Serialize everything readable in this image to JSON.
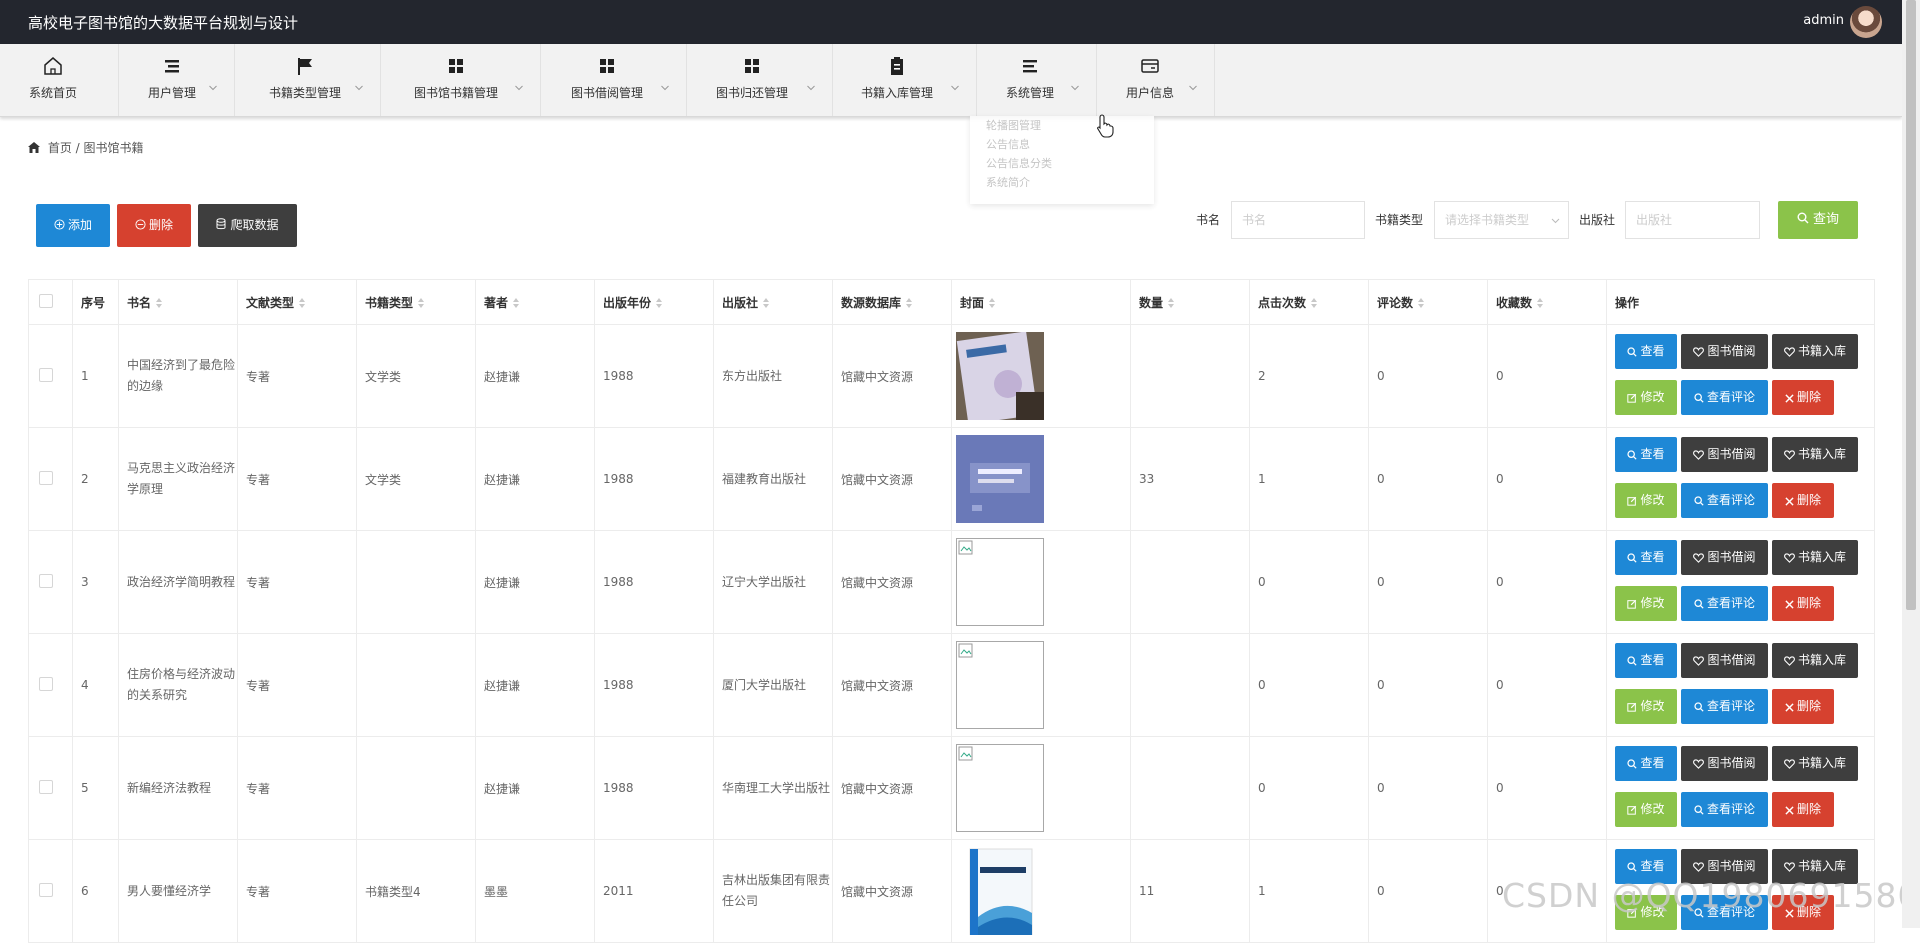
{
  "header": {
    "title": "高校电子图书馆的大数据平台规划与设计",
    "user": "admin"
  },
  "nav": [
    {
      "label": "系统首页",
      "icon": "home-icon"
    },
    {
      "label": "用户管理",
      "icon": "list-icon"
    },
    {
      "label": "书籍类型管理",
      "icon": "flag-icon"
    },
    {
      "label": "图书馆书籍管理",
      "icon": "grid-icon"
    },
    {
      "label": "图书借阅管理",
      "icon": "grid-icon"
    },
    {
      "label": "图书归还管理",
      "icon": "grid-icon"
    },
    {
      "label": "书籍入库管理",
      "icon": "clipboard-icon"
    },
    {
      "label": "系统管理",
      "icon": "menu-icon"
    },
    {
      "label": "用户信息",
      "icon": "card-icon"
    }
  ],
  "dropdown": [
    "轮播图管理",
    "公告信息",
    "公告信息分类",
    "系统简介"
  ],
  "breadcrumb": {
    "home": "首页",
    "sep": "/",
    "current": "图书馆书籍"
  },
  "toolbar": {
    "add": "添加",
    "delete": "删除",
    "crawl": "爬取数据"
  },
  "search": {
    "name_label": "书名",
    "name_placeholder": "书名",
    "type_label": "书籍类型",
    "type_placeholder": "请选择书籍类型",
    "publisher_label": "出版社",
    "publisher_placeholder": "出版社",
    "button": "查询"
  },
  "table": {
    "headers": [
      "序号",
      "书名",
      "文献类型",
      "书籍类型",
      "著者",
      "出版年份",
      "出版社",
      "数源数据库",
      "封面",
      "数量",
      "点击次数",
      "评论数",
      "收藏数",
      "操作"
    ],
    "rows": [
      {
        "no": "1",
        "name": "中国经济到了最危险的边缘",
        "doc_type": "专著",
        "book_type": "文学类",
        "author": "赵捷谦",
        "year": "1988",
        "publisher": "东方出版社",
        "db": "馆藏中文资源",
        "cover": "photo-a",
        "qty": "",
        "clicks": "2",
        "comments": "0",
        "favs": "0"
      },
      {
        "no": "2",
        "name": "马克思主义政治经济学原理",
        "doc_type": "专著",
        "book_type": "文学类",
        "author": "赵捷谦",
        "year": "1988",
        "publisher": "福建教育出版社",
        "db": "馆藏中文资源",
        "cover": "photo-b",
        "qty": "33",
        "clicks": "1",
        "comments": "0",
        "favs": "0"
      },
      {
        "no": "3",
        "name": "政治经济学简明教程",
        "doc_type": "专著",
        "book_type": "",
        "author": "赵捷谦",
        "year": "1988",
        "publisher": "辽宁大学出版社",
        "db": "馆藏中文资源",
        "cover": "broken",
        "qty": "",
        "clicks": "0",
        "comments": "0",
        "favs": "0"
      },
      {
        "no": "4",
        "name": "住房价格与经济波动的关系研究",
        "doc_type": "专著",
        "book_type": "",
        "author": "赵捷谦",
        "year": "1988",
        "publisher": "厦门大学出版社",
        "db": "馆藏中文资源",
        "cover": "broken",
        "qty": "",
        "clicks": "0",
        "comments": "0",
        "favs": "0"
      },
      {
        "no": "5",
        "name": "新编经济法教程",
        "doc_type": "专著",
        "book_type": "",
        "author": "赵捷谦",
        "year": "1988",
        "publisher": "华南理工大学出版社",
        "db": "馆藏中文资源",
        "cover": "broken",
        "qty": "",
        "clicks": "0",
        "comments": "0",
        "favs": "0"
      },
      {
        "no": "6",
        "name": "男人要懂经济学",
        "doc_type": "专著",
        "book_type": "书籍类型4",
        "author": "墨墨",
        "year": "2011",
        "publisher": "吉林出版集团有限责任公司",
        "db": "馆藏中文资源",
        "cover": "photo-c",
        "qty": "11",
        "clicks": "1",
        "comments": "0",
        "favs": "0"
      }
    ],
    "actions": {
      "view": "查看",
      "borrow": "图书借阅",
      "stock": "书籍入库",
      "edit": "修改",
      "comments": "查看评论",
      "delete": "删除"
    }
  },
  "colors": {
    "primary": "#1e88d6",
    "danger": "#d6412f",
    "dark": "#3e3e3e",
    "success": "#8bc34a",
    "header": "#23262e"
  },
  "watermark": "CSDN @QQ1980691580"
}
